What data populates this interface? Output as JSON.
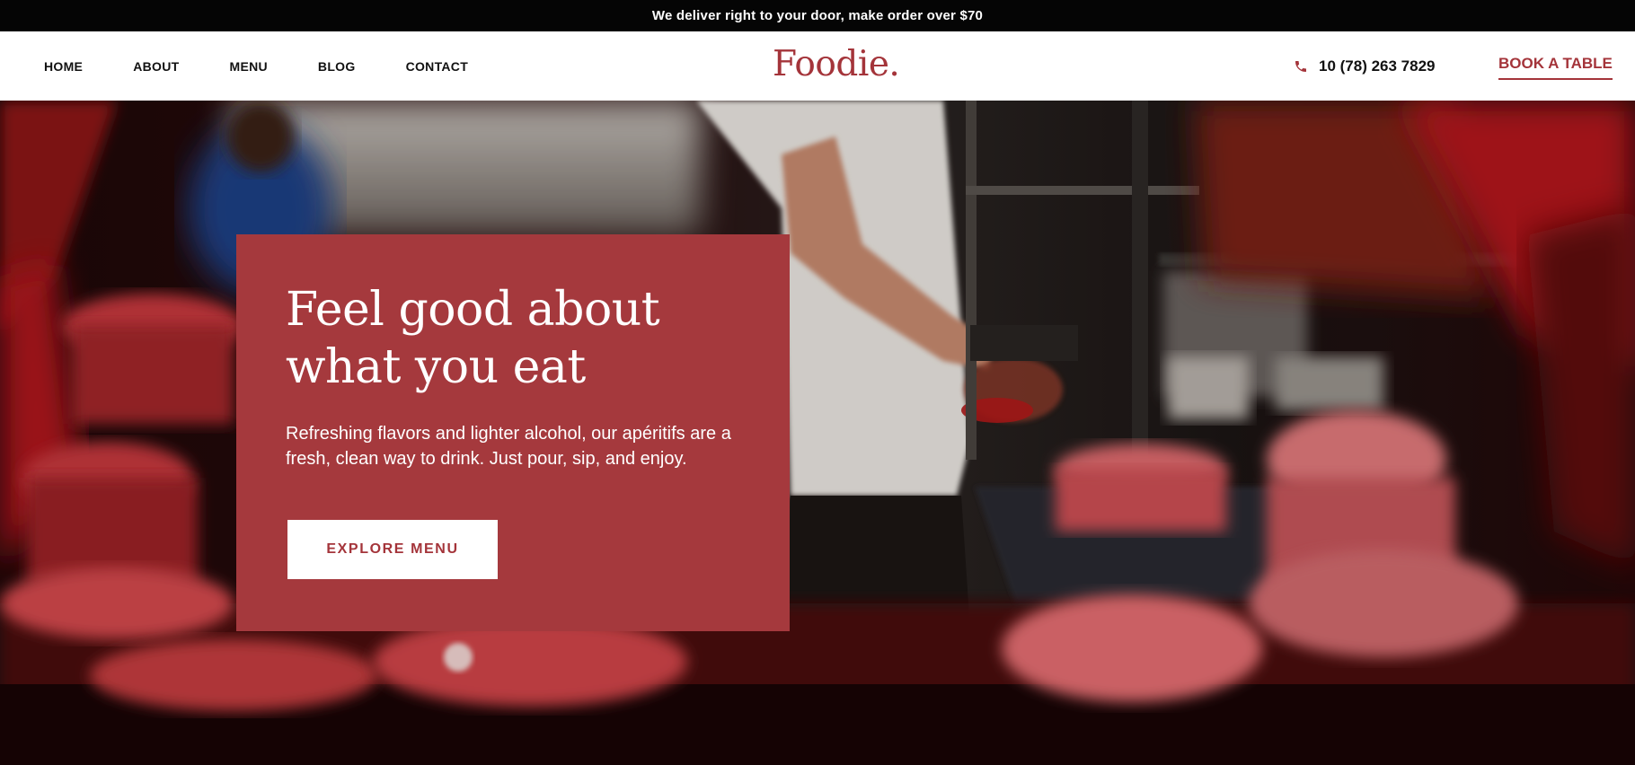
{
  "announcement": "We deliver right to your door, make order over $70",
  "nav": {
    "items": [
      "HOME",
      "ABOUT",
      "MENU",
      "BLOG",
      "CONTACT"
    ]
  },
  "brand": {
    "logo": "Foodie.",
    "color": "#a4343a"
  },
  "contact": {
    "phone_icon": "phone-icon",
    "phone": "10 (78) 263 7829"
  },
  "cta": {
    "book_label": "BOOK A TABLE"
  },
  "hero": {
    "title": "Feel good about what you eat",
    "text": "Refreshing flavors and lighter alcohol, our apéritifs are a fresh, clean way to drink. Just pour, sip, and enjoy.",
    "button_label": "EXPLORE MENU",
    "card_color": "#a5393d"
  }
}
